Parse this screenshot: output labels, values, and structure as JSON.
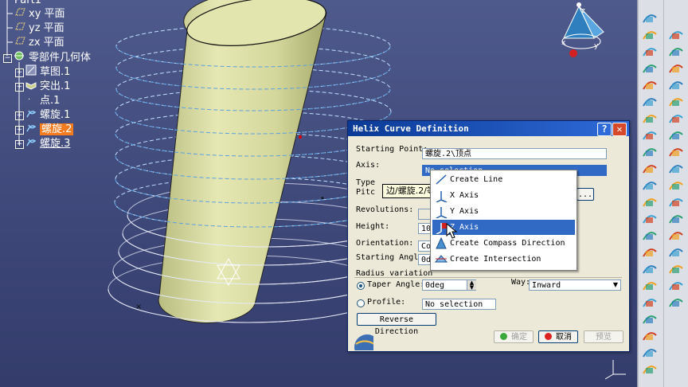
{
  "tree": {
    "root": "Part1",
    "items": [
      {
        "label": "xy 平面",
        "icon": "plane-icon"
      },
      {
        "label": "yz 平面",
        "icon": "plane-icon"
      },
      {
        "label": "zx 平面",
        "icon": "plane-icon"
      },
      {
        "label": "零部件几何体",
        "icon": "body-icon"
      },
      {
        "label": "草图.1",
        "icon": "sketch-icon"
      },
      {
        "label": "突出.1",
        "icon": "pad-icon"
      },
      {
        "label": "点.1",
        "icon": "point-icon"
      },
      {
        "label": "螺旋.1",
        "icon": "helix-icon"
      },
      {
        "label": "螺旋.2",
        "icon": "helix-icon"
      },
      {
        "label": "螺旋.3",
        "icon": "helix-icon"
      }
    ]
  },
  "dialog": {
    "title": "Helix Curve Definition",
    "help": "?",
    "close": "✕",
    "starting_point_label": "Starting Point:",
    "starting_point_value": "螺旋.2\\顶点",
    "axis_label": "Axis:",
    "axis_value": "No selection",
    "type_label": "Type",
    "pitch_label": "Pitc",
    "revolutions_label": "Revolutions:",
    "height_label": "Height:",
    "height_value": "10m",
    "orientation_label": "Orientation:",
    "orientation_value": "Cou",
    "starting_angle_label": "Starting Angle:",
    "starting_angle_value": "0de",
    "radius_variation_label": "Radius variation",
    "taper_angle_label": "Taper Angle:",
    "taper_angle_value": "0deg",
    "way_label": "Way:",
    "way_value": "Inward",
    "profile_label": "Profile:",
    "profile_value": "No selection",
    "reverse_direction": "Reverse Direction",
    "ok": "确定",
    "cancel": "取消",
    "preview": "预览",
    "more_button": "..."
  },
  "tooltip": "边/螺旋.2/等",
  "menu": {
    "items": [
      {
        "label": "Create Line",
        "icon": "line-icon"
      },
      {
        "label": "X Axis",
        "icon": "x-axis-icon"
      },
      {
        "label": "Y Axis",
        "icon": "y-axis-icon"
      },
      {
        "label": "Z Axis",
        "icon": "z-axis-icon"
      },
      {
        "label": "Create Compass Direction",
        "icon": "compass-direction-icon"
      },
      {
        "label": "Create Intersection",
        "icon": "intersection-icon"
      }
    ]
  },
  "compass": {
    "x": "x",
    "y": "y",
    "z": "z"
  },
  "colors": {
    "selection": "#316ac5",
    "tree_selected": "#f47b20",
    "titlebar": "#0a3a96",
    "viewport": "#454f80"
  }
}
